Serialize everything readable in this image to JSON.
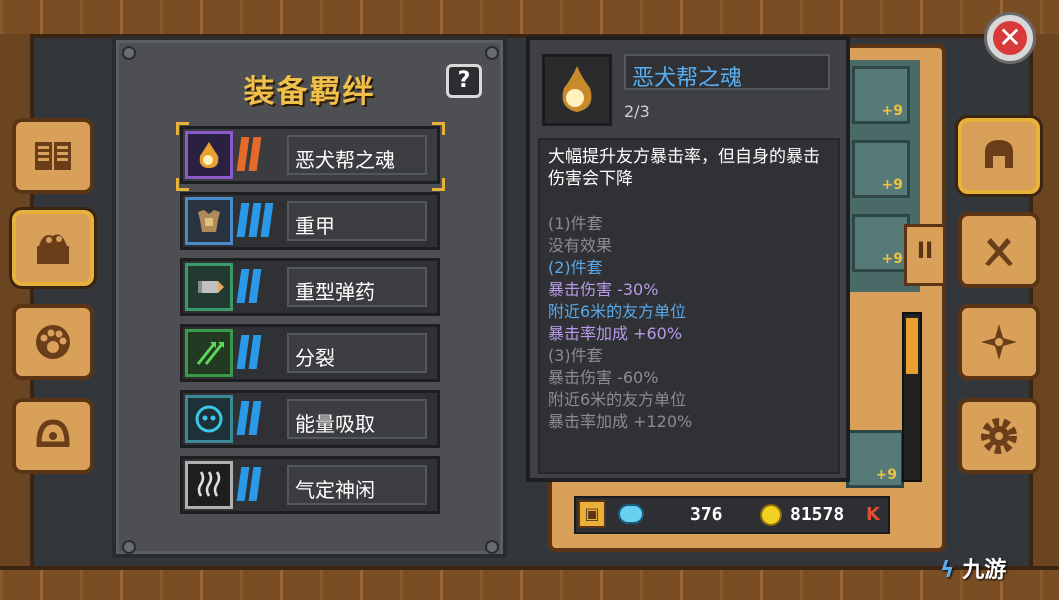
{
  "panel": {
    "title": "装备羁绊",
    "help_label": "?"
  },
  "bonds": [
    {
      "label": "恶犬帮之魂",
      "icon": "flame-spirit-icon",
      "icon_bg": "#2a2040",
      "icon_border": "#8a5ac8",
      "count_color": "#e86a2a",
      "selected": true
    },
    {
      "label": "重甲",
      "icon": "heavy-armor-icon",
      "icon_bg": "#2a3440",
      "icon_border": "#4a8ac8",
      "count_color": "#2a9ae8",
      "selected": false
    },
    {
      "label": "重型弹药",
      "icon": "heavy-ammo-icon",
      "icon_bg": "#223a30",
      "icon_border": "#3a9a6a",
      "count_color": "#2a9ae8",
      "selected": false
    },
    {
      "label": "分裂",
      "icon": "split-arrows-icon",
      "icon_bg": "#223a22",
      "icon_border": "#3a9a4a",
      "count_color": "#2a9ae8",
      "selected": false
    },
    {
      "label": "能量吸取",
      "icon": "energy-drain-icon",
      "icon_bg": "#1e3038",
      "icon_border": "#3a8a9a",
      "count_color": "#2a9ae8",
      "selected": false
    },
    {
      "label": "气定神闲",
      "icon": "calm-steam-icon",
      "icon_bg": "#1e1e1e",
      "icon_border": "#b0b0b0",
      "count_color": "#2a9ae8",
      "selected": false
    }
  ],
  "tooltip": {
    "name": "恶犬帮之魂",
    "progress": "2/3",
    "description": "大幅提升友方暴击率，但自身的暴击伤害会下降",
    "tiers": [
      {
        "text": "(1)件套",
        "color": "#8a8c8e"
      },
      {
        "text": "没有效果",
        "color": "#8a8c8e"
      },
      {
        "text": "(2)件套",
        "color": "#5aa8e8"
      },
      {
        "text": "暴击伤害 -30%",
        "color": "#b89ae8"
      },
      {
        "text": "附近6米的友方单位",
        "color": "#5aa8e8"
      },
      {
        "text": "暴击率加成 +60%",
        "color": "#b89ae8"
      },
      {
        "text": "(3)件套",
        "color": "#8a8c8e"
      },
      {
        "text": "暴击伤害 -60%",
        "color": "#8a8c8e"
      },
      {
        "text": "附近6米的友方单位",
        "color": "#8a8c8e"
      },
      {
        "text": "暴击率加成 +120%",
        "color": "#8a8c8e"
      }
    ]
  },
  "inventory": {
    "slots": [
      "+9",
      "+9",
      "+9",
      "+9"
    ],
    "page_marker": "II"
  },
  "currency": {
    "gems": "376",
    "coins": "81578",
    "coins_suffix": "K"
  },
  "side_tabs_left": [
    "codex-book-icon",
    "equipment-chest-icon",
    "pet-paw-icon",
    "bell-icon"
  ],
  "side_tabs_right": [
    "helmet-icon",
    "weapons-icon",
    "talent-icon",
    "gear-icon"
  ],
  "close_label": "✕",
  "watermark": "九游"
}
